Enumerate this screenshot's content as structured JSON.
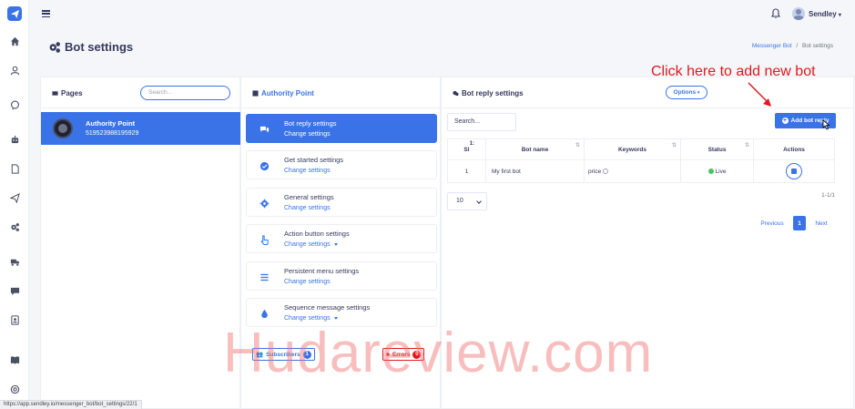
{
  "header": {
    "username": "Sendley"
  },
  "page_title": "Bot settings",
  "breadcrumb": {
    "link": "Messenger Bot",
    "separator": "/",
    "current": "Bot settings"
  },
  "annotation": "Click here to add new bot",
  "pages_panel": {
    "title": "Pages",
    "search_placeholder": "Search...",
    "items": [
      {
        "name": "Authority Point",
        "id": "519523988195929"
      }
    ]
  },
  "settings_panel": {
    "title": "Authority Point",
    "items": [
      {
        "title": "Bot reply settings",
        "sub": "Change settings",
        "icon": "chat-icon"
      },
      {
        "title": "Get started settings",
        "sub": "Change settings",
        "icon": "check-circle-icon"
      },
      {
        "title": "General settings",
        "sub": "Change settings",
        "icon": "gear-icon"
      },
      {
        "title": "Action button settings",
        "sub": "Change settings",
        "icon": "hand-pointer-icon"
      },
      {
        "title": "Persistent menu settings",
        "sub": "Change settings",
        "icon": "bars-icon"
      },
      {
        "title": "Sequence message settings",
        "sub": "Change settings",
        "icon": "drop-icon"
      }
    ],
    "subscribers_label": "Subscribers",
    "subscribers_count": "1",
    "errors_label": "Errors",
    "errors_count": "0"
  },
  "reply_panel": {
    "title": "Bot reply settings",
    "options_label": "Options",
    "search_placeholder": "Search...",
    "add_button": "Add bot reply",
    "columns": [
      "Sl",
      "Bot name",
      "Keywords",
      "Status",
      "Actions"
    ],
    "rows": [
      {
        "sl": "1",
        "bot_name": "My first bot",
        "keywords": "price",
        "status": "Live"
      }
    ],
    "per_page": "10",
    "range": "1-1/1",
    "pagination": {
      "prev": "Previous",
      "current": "1",
      "next": "Next"
    }
  },
  "watermark": "Hudareview.com",
  "status_url": "https://app.sendley.io/messenger_bot/bot_settings/22/1",
  "colors": {
    "accent": "#3a73e8",
    "annotation": "#e0191f",
    "live": "#47c363"
  }
}
